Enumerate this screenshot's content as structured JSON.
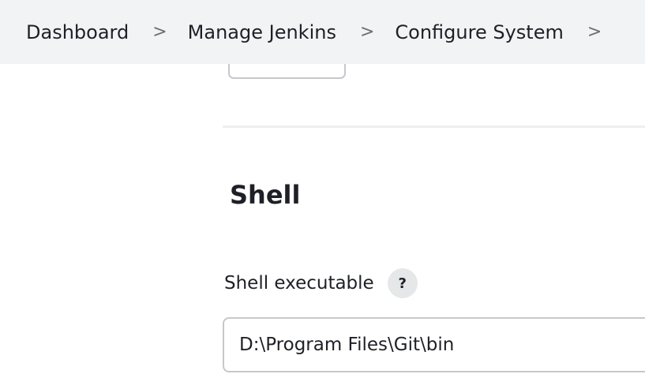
{
  "breadcrumb": {
    "items": [
      {
        "label": "Dashboard"
      },
      {
        "label": "Manage Jenkins"
      },
      {
        "label": "Configure System"
      }
    ],
    "separator": ">"
  },
  "section": {
    "title": "Shell"
  },
  "shell_executable": {
    "label": "Shell executable",
    "help_label": "?",
    "value": "D:\\Program Files\\Git\\bin"
  }
}
